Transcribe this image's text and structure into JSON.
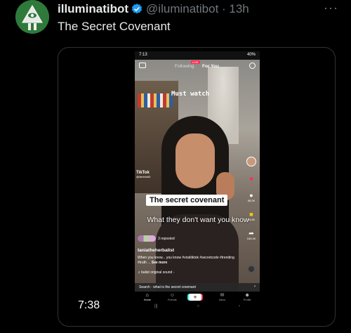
{
  "tweet": {
    "display_name": "illuminatibot",
    "handle_time": "@iluminatibot · 13h",
    "more_label": "···",
    "text": "The Secret Covenant"
  },
  "video": {
    "timecode": "7:38",
    "status_time": "7:13",
    "status_right": "40%",
    "nav_following": "Following",
    "nav_live_badge": "LIVE",
    "nav_foryou": "For You",
    "overlay_top": "Must watch",
    "watermark": "TikTok",
    "watermark_handle": "@iamblu83",
    "caption_box": "The secret covenant",
    "caption_plain": "What they don't want you know",
    "reposted": "3 reposted",
    "username": "taniatheherbalist",
    "description": "When you know... you know #viraltiktok #secretcode #trending #truth ...",
    "see_more": "See more",
    "sound": "♫ balist  original sound -",
    "rail_counts": [
      "",
      "",
      "58.0K",
      "94.6K",
      "183.0K"
    ],
    "search_text": "Search · what is the secret covenant",
    "tabs": [
      {
        "label": "Home",
        "icon": "⌂"
      },
      {
        "label": "Friends",
        "icon": "☺"
      },
      {
        "label": "",
        "icon": "+"
      },
      {
        "label": "Inbox",
        "icon": "✉"
      },
      {
        "label": "Profile",
        "icon": "☻"
      }
    ],
    "android_nav": [
      "|||",
      "○",
      "‹"
    ]
  },
  "colors": {
    "background": "#000000",
    "verified": "#1d9bf0",
    "muted": "#71767b",
    "tiktok_red": "#fe2c55",
    "tiktok_cyan": "#25f4ee"
  },
  "icons": {
    "avatar": "illuminati-eye-pyramid-avatar",
    "verified": "verified-badge-icon",
    "more": "more-horizontal-icon"
  }
}
